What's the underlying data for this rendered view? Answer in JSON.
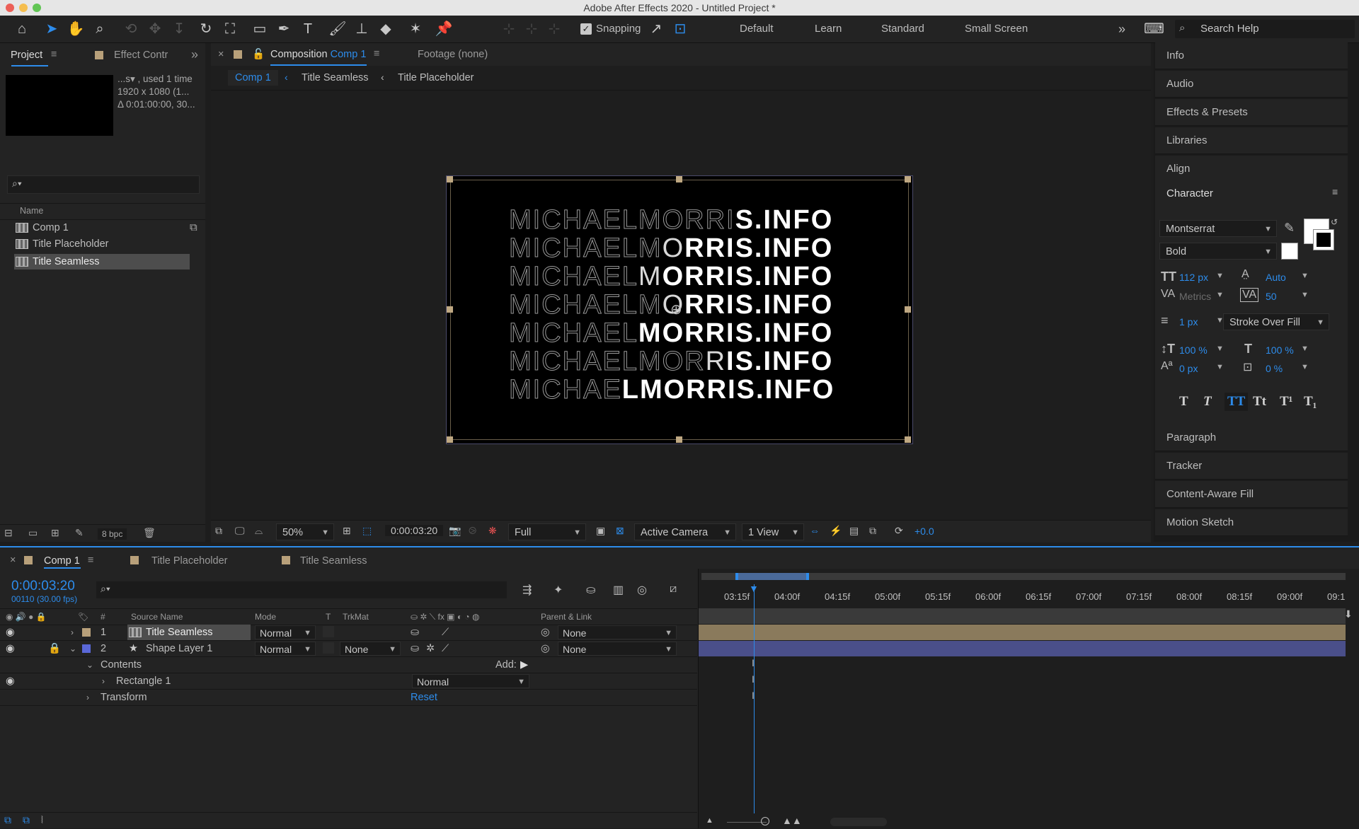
{
  "window": {
    "title": "Adobe After Effects 2020 - Untitled Project *"
  },
  "toolbar": {
    "snapping_label": "Snapping",
    "workspaces": [
      "Default",
      "Learn",
      "Standard",
      "Small Screen"
    ],
    "search_placeholder": "Search Help"
  },
  "project_panel": {
    "tab_project": "Project",
    "tab_effect": "Effect Contr",
    "info_line1": "...s▾ , used 1 time",
    "info_line2": "1920 x 1080 (1...",
    "info_line3": "Δ 0:01:00:00, 30...",
    "column_name": "Name",
    "items": [
      {
        "label": "Comp 1"
      },
      {
        "label": "Title Placeholder"
      },
      {
        "label": "Title Seamless"
      }
    ],
    "bpc": "8 bpc"
  },
  "comp_panel": {
    "tab_prefix": "Composition",
    "tab_comp": "Comp 1",
    "tab_footage": "Footage (none)",
    "breadcrumbs": [
      "Comp 1",
      "Title Seamless",
      "Title Placeholder"
    ],
    "text_lines": [
      [
        "MICHAELMORRI",
        "",
        "S.INFO"
      ],
      [
        "MICHAELM",
        "O",
        "RRIS.INFO"
      ],
      [
        "MICHAEL",
        "M",
        "ORRIS.INFO"
      ],
      [
        "MICHAELM",
        "O",
        "RRIS.INFO"
      ],
      [
        "MICHAEL",
        "",
        "MORRIS.INFO"
      ],
      [
        "MICHAELMOR",
        "R",
        "IS.INFO"
      ],
      [
        "MICHAE",
        "",
        "LMORRIS.INFO"
      ]
    ],
    "footer": {
      "zoom": "50%",
      "timecode": "0:00:03:20",
      "resolution": "Full",
      "camera": "Active Camera",
      "views": "1 View",
      "exposure": "+0.0"
    }
  },
  "right_panel": {
    "items_top": [
      "Info",
      "Audio",
      "Effects & Presets",
      "Libraries",
      "Align"
    ],
    "character": {
      "title": "Character",
      "font": "Montserrat",
      "style": "Bold",
      "size": "112 px",
      "leading": "Auto",
      "kerning": "Metrics",
      "tracking": "50",
      "stroke_width": "1 px",
      "stroke_mode": "Stroke Over Fill",
      "vscale": "100 %",
      "hscale": "100 %",
      "baseline": "0 px",
      "tsume": "0 %",
      "style_buttons": [
        "T",
        "T",
        "TT",
        "Tt",
        "T¹",
        "T₁"
      ]
    },
    "items_bottom": [
      "Paragraph",
      "Tracker",
      "Content-Aware Fill",
      "Motion Sketch"
    ]
  },
  "timeline": {
    "tabs": [
      "Comp 1",
      "Title Placeholder",
      "Title Seamless"
    ],
    "timecode": "0:00:03:20",
    "frames": "00110 (30.00 fps)",
    "columns": {
      "num": "#",
      "source": "Source Name",
      "mode": "Mode",
      "t": "T",
      "trkmat": "TrkMat",
      "parent": "Parent & Link"
    },
    "layers": [
      {
        "num": "1",
        "name": "Title Seamless",
        "mode": "Normal",
        "trkmat": "",
        "parent": "None"
      },
      {
        "num": "2",
        "name": "Shape Layer 1",
        "mode": "Normal",
        "trkmat": "None",
        "parent": "None"
      }
    ],
    "contents_label": "Contents",
    "add_label": "Add:",
    "rectangle_label": "Rectangle 1",
    "rectangle_mode": "Normal",
    "transform_label": "Transform",
    "reset_label": "Reset",
    "ruler": [
      "03:15f",
      "04:00f",
      "04:15f",
      "05:00f",
      "05:15f",
      "06:00f",
      "06:15f",
      "07:00f",
      "07:15f",
      "08:00f",
      "08:15f",
      "09:00f",
      "09:1"
    ]
  },
  "colors": {
    "accent": "#2d8ceb",
    "layer1_bar": "#8a7a5c",
    "layer2_bar": "#4a4f8a"
  }
}
